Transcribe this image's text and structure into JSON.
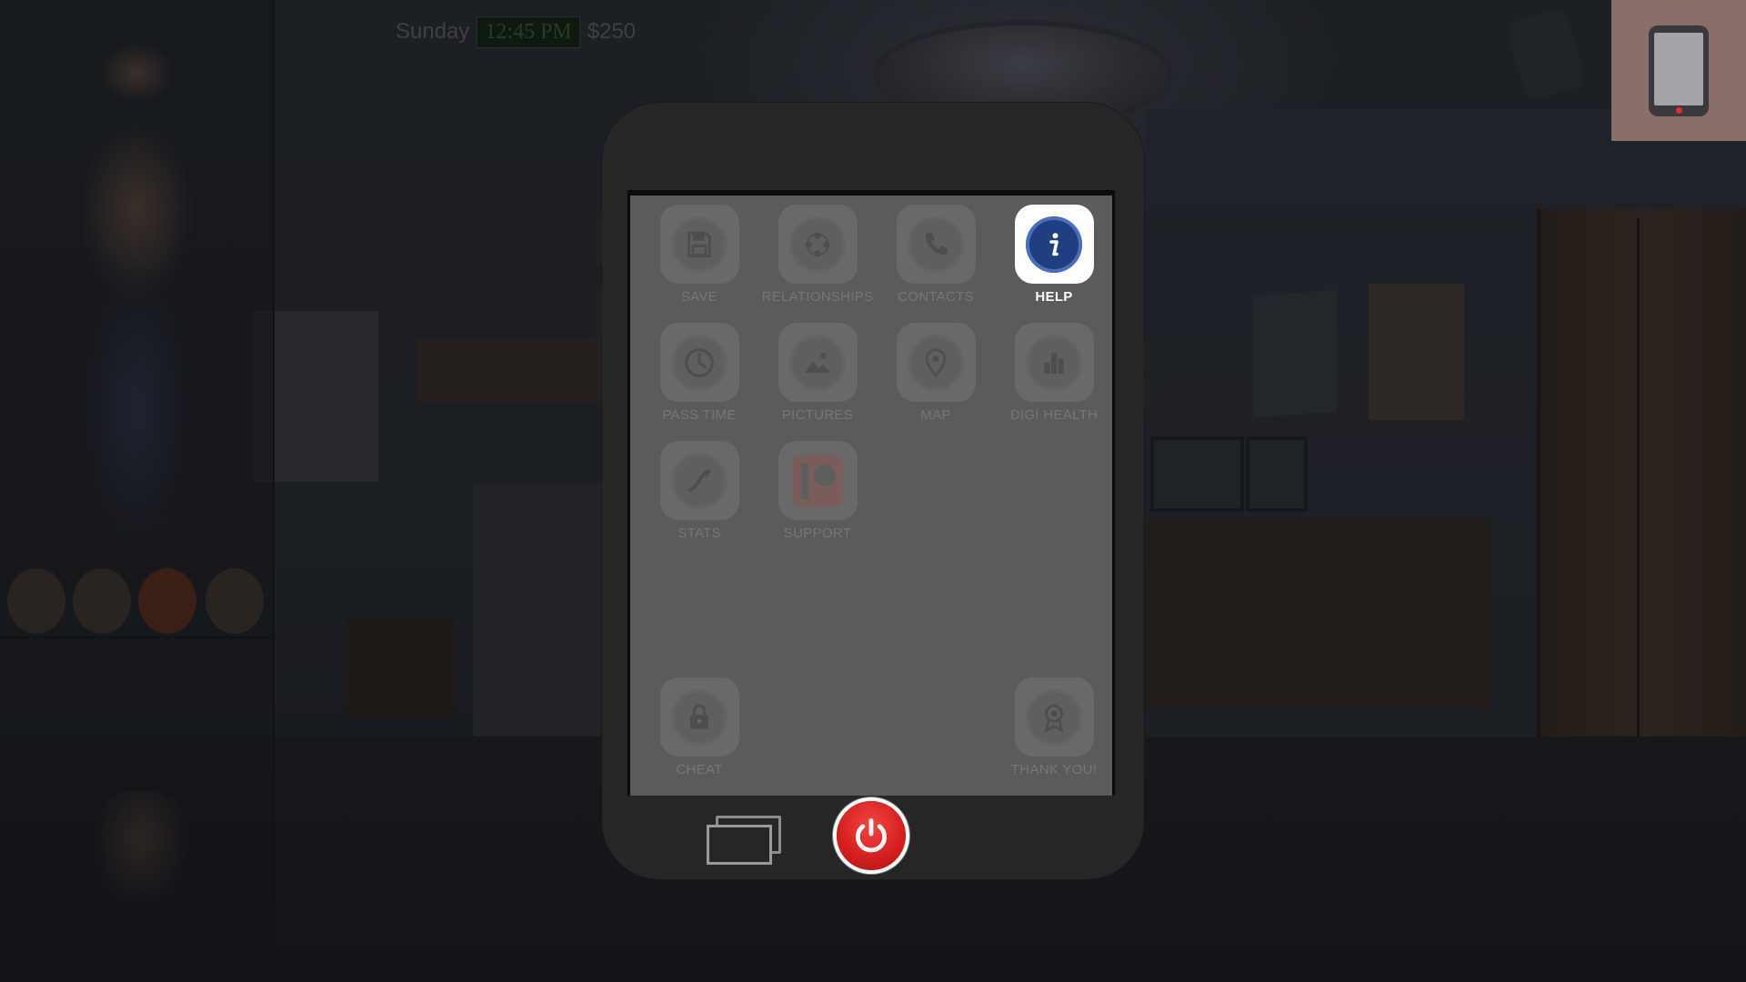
{
  "hud": {
    "day": "Sunday",
    "time": "12:45 PM",
    "money": "$250"
  },
  "phone": {
    "apps": [
      {
        "id": "save",
        "label": "SAVE",
        "icon": "floppy-disk-icon",
        "active": false
      },
      {
        "id": "relationships",
        "label": "RELATIONSHIPS",
        "icon": "relationships-icon",
        "active": false
      },
      {
        "id": "contacts",
        "label": "CONTACTS",
        "icon": "phone-handset-icon",
        "active": false
      },
      {
        "id": "help",
        "label": "HELP",
        "icon": "info-icon",
        "active": true
      },
      {
        "id": "pass-time",
        "label": "PASS TIME",
        "icon": "clock-icon",
        "active": false
      },
      {
        "id": "pictures",
        "label": "PICTURES",
        "icon": "picture-icon",
        "active": false
      },
      {
        "id": "map",
        "label": "MAP",
        "icon": "map-pin-icon",
        "active": false
      },
      {
        "id": "digi-health",
        "label": "DIGI HEALTH",
        "icon": "bar-chart-icon",
        "active": false
      },
      {
        "id": "stats",
        "label": "STATS",
        "icon": "stats-icon",
        "active": false
      },
      {
        "id": "support",
        "label": "SUPPORT",
        "icon": "patreon-icon",
        "active": false
      },
      {
        "id": "cheat",
        "label": "CHEAT",
        "icon": "lock-icon",
        "active": false
      },
      {
        "id": "thank-you",
        "label": "THANK YOU!",
        "icon": "award-ribbon-icon",
        "active": false
      }
    ],
    "bottom_buttons": {
      "windows": "windows-icon",
      "power": "power-icon"
    }
  },
  "colors": {
    "help_accent": "#1f3f82",
    "power_red": "#d41e1e",
    "phone_body": "#262626",
    "screen": "#5b5b5b"
  }
}
